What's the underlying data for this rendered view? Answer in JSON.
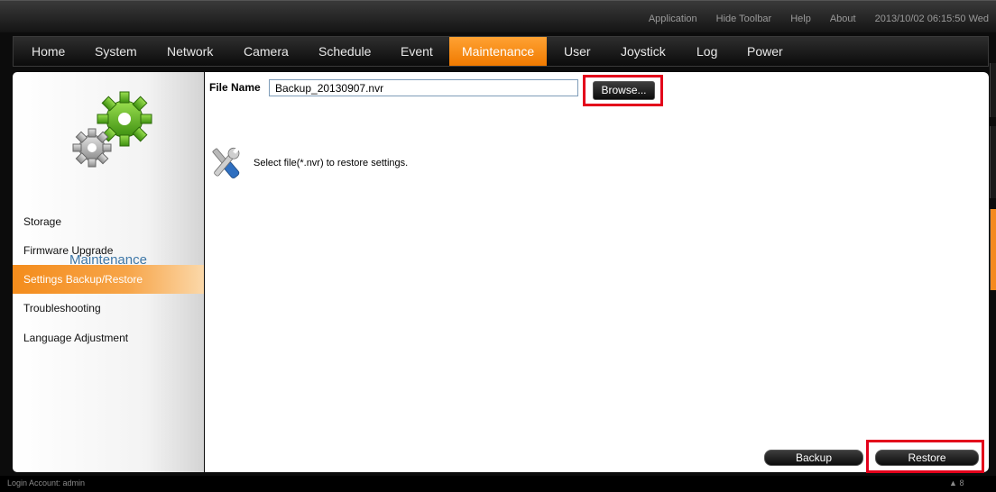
{
  "toolbar": {
    "links": [
      "Application",
      "Hide Toolbar",
      "Help",
      "About"
    ],
    "datetime": "2013/10/02 06:15:50 Wed"
  },
  "nav": {
    "tabs": [
      "Home",
      "System",
      "Network",
      "Camera",
      "Schedule",
      "Event",
      "Maintenance",
      "User",
      "Joystick",
      "Log",
      "Power"
    ],
    "active": "Maintenance"
  },
  "sidebar": {
    "title": "Maintenance",
    "items": [
      "Storage",
      "Firmware Upgrade",
      "Settings Backup/Restore",
      "Troubleshooting",
      "Language Adjustment"
    ],
    "active": "Settings Backup/Restore"
  },
  "form": {
    "file_label": "File Name",
    "file_value": "Backup_20130907.nvr",
    "browse_label": "Browse...",
    "hint": "Select file(*.nvr) to restore settings.",
    "backup_label": "Backup",
    "restore_label": "Restore"
  },
  "status": {
    "login": "Login Account: admin",
    "signal_count": "8"
  },
  "icons": {
    "settings": "gears-icon",
    "tools": "wrench-screwdriver-icon",
    "network": "network-icon"
  },
  "colors": {
    "accent_orange": "#f58a1f",
    "highlight_red": "#e3001b",
    "sidebar_title_blue": "#3f78a8"
  }
}
